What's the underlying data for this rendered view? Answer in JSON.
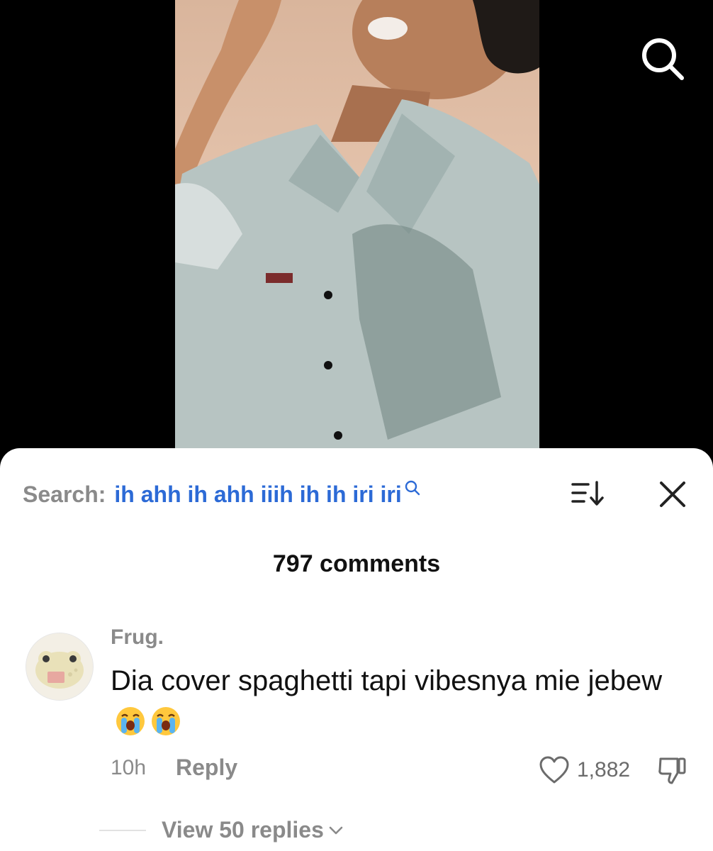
{
  "video": {
    "icons": {
      "search": "search-icon"
    }
  },
  "comments_sheet": {
    "search_prefix": "Search:",
    "search_query": "ih ahh ih ahh iiih ih ih iri iri",
    "icons": {
      "query_search": "search-icon",
      "sort": "sort-icon",
      "close": "close-icon"
    },
    "count_label": "797 comments",
    "comment": {
      "username": "Frug.",
      "text": "Dia cover spaghetti tapi vibesnya mie jebew",
      "emojis": [
        "loudly-crying-face",
        "loudly-crying-face"
      ],
      "time": "10h",
      "reply_label": "Reply",
      "like_count": "1,882",
      "icons": {
        "like": "heart-icon",
        "dislike": "dislike-icon"
      }
    },
    "view_replies_label": "View 50 replies"
  },
  "colors": {
    "accent_query": "#2c6ad6",
    "muted_text": "#8a8a8a",
    "sheet_bg": "#ffffff",
    "backdrop": "#000000"
  }
}
